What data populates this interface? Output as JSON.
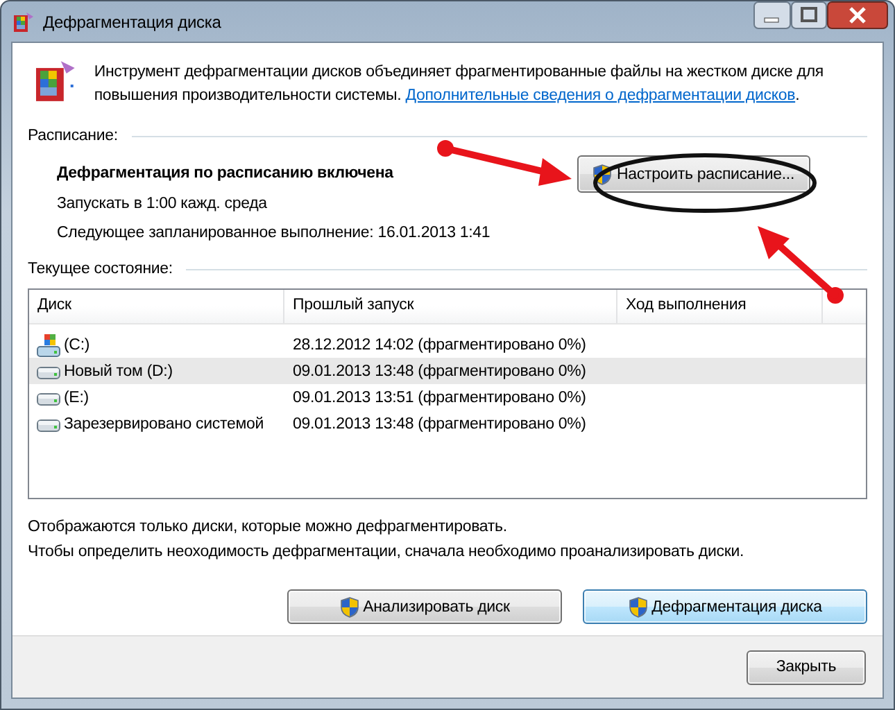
{
  "window": {
    "title": "Дефрагментация диска"
  },
  "intro": {
    "text": "Инструмент дефрагментации дисков объединяет фрагментированные файлы на жестком диске для повышения производительности системы. ",
    "link": "Дополнительные сведения о дефрагментации дисков",
    "after": "."
  },
  "schedule": {
    "heading": "Расписание:",
    "status": "Дефрагментация по расписанию включена",
    "run": "Запускать в 1:00 кажд. среда",
    "next": "Следующее запланированное выполнение: 16.01.2013 1:41",
    "button": "Настроить расписание..."
  },
  "current": {
    "heading": "Текущее состояние:",
    "columns": [
      "Диск",
      "Прошлый запуск",
      "Ход выполнения"
    ],
    "rows": [
      {
        "kind": "system",
        "disk": "(C:)",
        "last_run": "28.12.2012 14:02 (фрагментировано 0%)",
        "selected": false
      },
      {
        "kind": "drive",
        "disk": "Новый том (D:)",
        "last_run": "09.01.2013 13:48 (фрагментировано 0%)",
        "selected": true
      },
      {
        "kind": "drive",
        "disk": "(E:)",
        "last_run": "09.01.2013 13:51 (фрагментировано 0%)",
        "selected": false
      },
      {
        "kind": "drive",
        "disk": "Зарезервировано системой",
        "last_run": "09.01.2013 13:48 (фрагментировано 0%)",
        "selected": false
      }
    ]
  },
  "notes": [
    "Отображаются только диски, которые можно дефрагментировать.",
    "Чтобы определить неоходимость  дефрагментации, сначала необходимо проанализировать диски."
  ],
  "actions": [
    {
      "label": "Анализировать диск",
      "default": false
    },
    {
      "label": "Дефрагментация диска",
      "default": true
    }
  ],
  "close_button": "Закрыть"
}
